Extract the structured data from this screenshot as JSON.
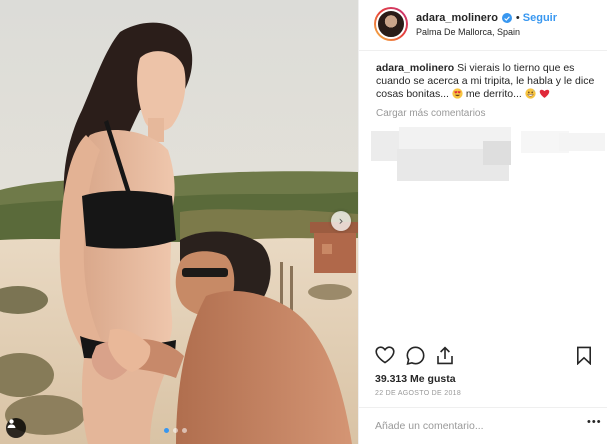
{
  "post": {
    "username": "adara_molinero",
    "verified": true,
    "follow_label": "Seguir",
    "bullet": "•",
    "location": "Palma De Mallorca, Spain",
    "caption": {
      "username": "adara_molinero",
      "text": "Si vierais lo tierno que es cuando se acerca a mi tripita, le habla y le dice cosas bonitas...",
      "text_after": "me derrito...",
      "emojis": [
        "heart-eyes-emoji",
        "grinning-sweat-emoji",
        "red-heart-emoji"
      ]
    },
    "load_more_label": "Cargar más comentarios",
    "likes": "39.313 Me gusta",
    "date": "22 DE AGOSTO DE 2018",
    "comment_placeholder": "Añade un comentario...",
    "more_options": "•••",
    "carousel": {
      "slides": 3,
      "active": 1
    }
  },
  "icons": {
    "like": "heart-outline-icon",
    "comment": "comment-bubble-icon",
    "share": "share-icon",
    "save": "bookmark-icon",
    "next": "chevron-right-icon",
    "tag": "user-tag-icon",
    "verified": "verified-badge-icon"
  },
  "colors": {
    "link_blue": "#3897f0",
    "text": "#262626",
    "muted": "#999999",
    "divider": "#efefef"
  }
}
